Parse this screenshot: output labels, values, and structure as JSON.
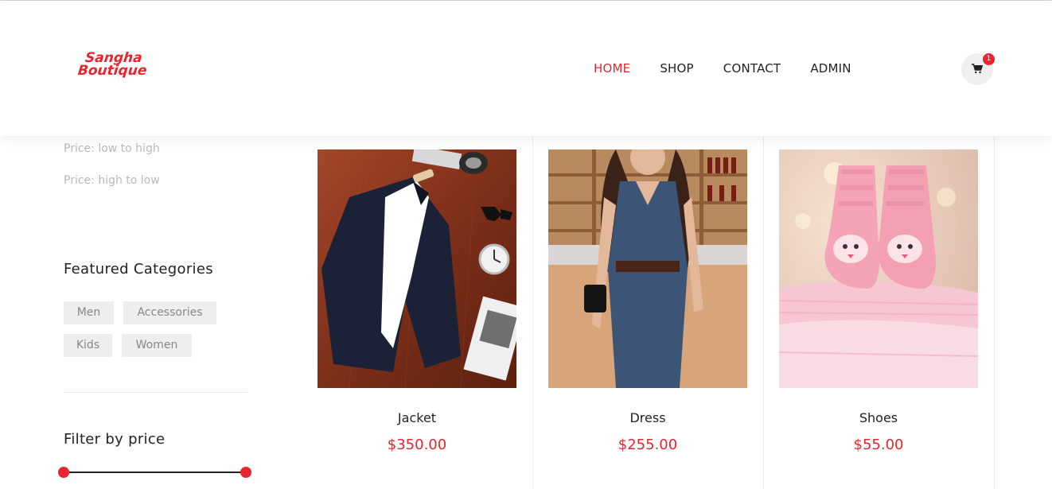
{
  "brand": {
    "line1": "Sangha",
    "line2": "Boutique"
  },
  "nav": {
    "items": [
      {
        "label": "HOME",
        "active": true
      },
      {
        "label": "SHOP",
        "active": false
      },
      {
        "label": "CONTACT",
        "active": false
      },
      {
        "label": "ADMIN",
        "active": false
      }
    ]
  },
  "cart": {
    "count": "1",
    "icon": "cart-icon"
  },
  "sidebar": {
    "sort_options": [
      "Price: low to high",
      "Price: high to low"
    ],
    "featured_title": "Featured Categories",
    "categories": [
      "Men",
      "Accessories",
      "Kids",
      "Women"
    ],
    "filter_title": "Filter by price"
  },
  "products": [
    {
      "name": "Jacket",
      "price": "$350.00"
    },
    {
      "name": "Dress",
      "price": "$255.00"
    },
    {
      "name": "Shoes",
      "price": "$55.00"
    }
  ],
  "colors": {
    "accent": "#e8252e",
    "tag_bg": "#eeeeee"
  }
}
